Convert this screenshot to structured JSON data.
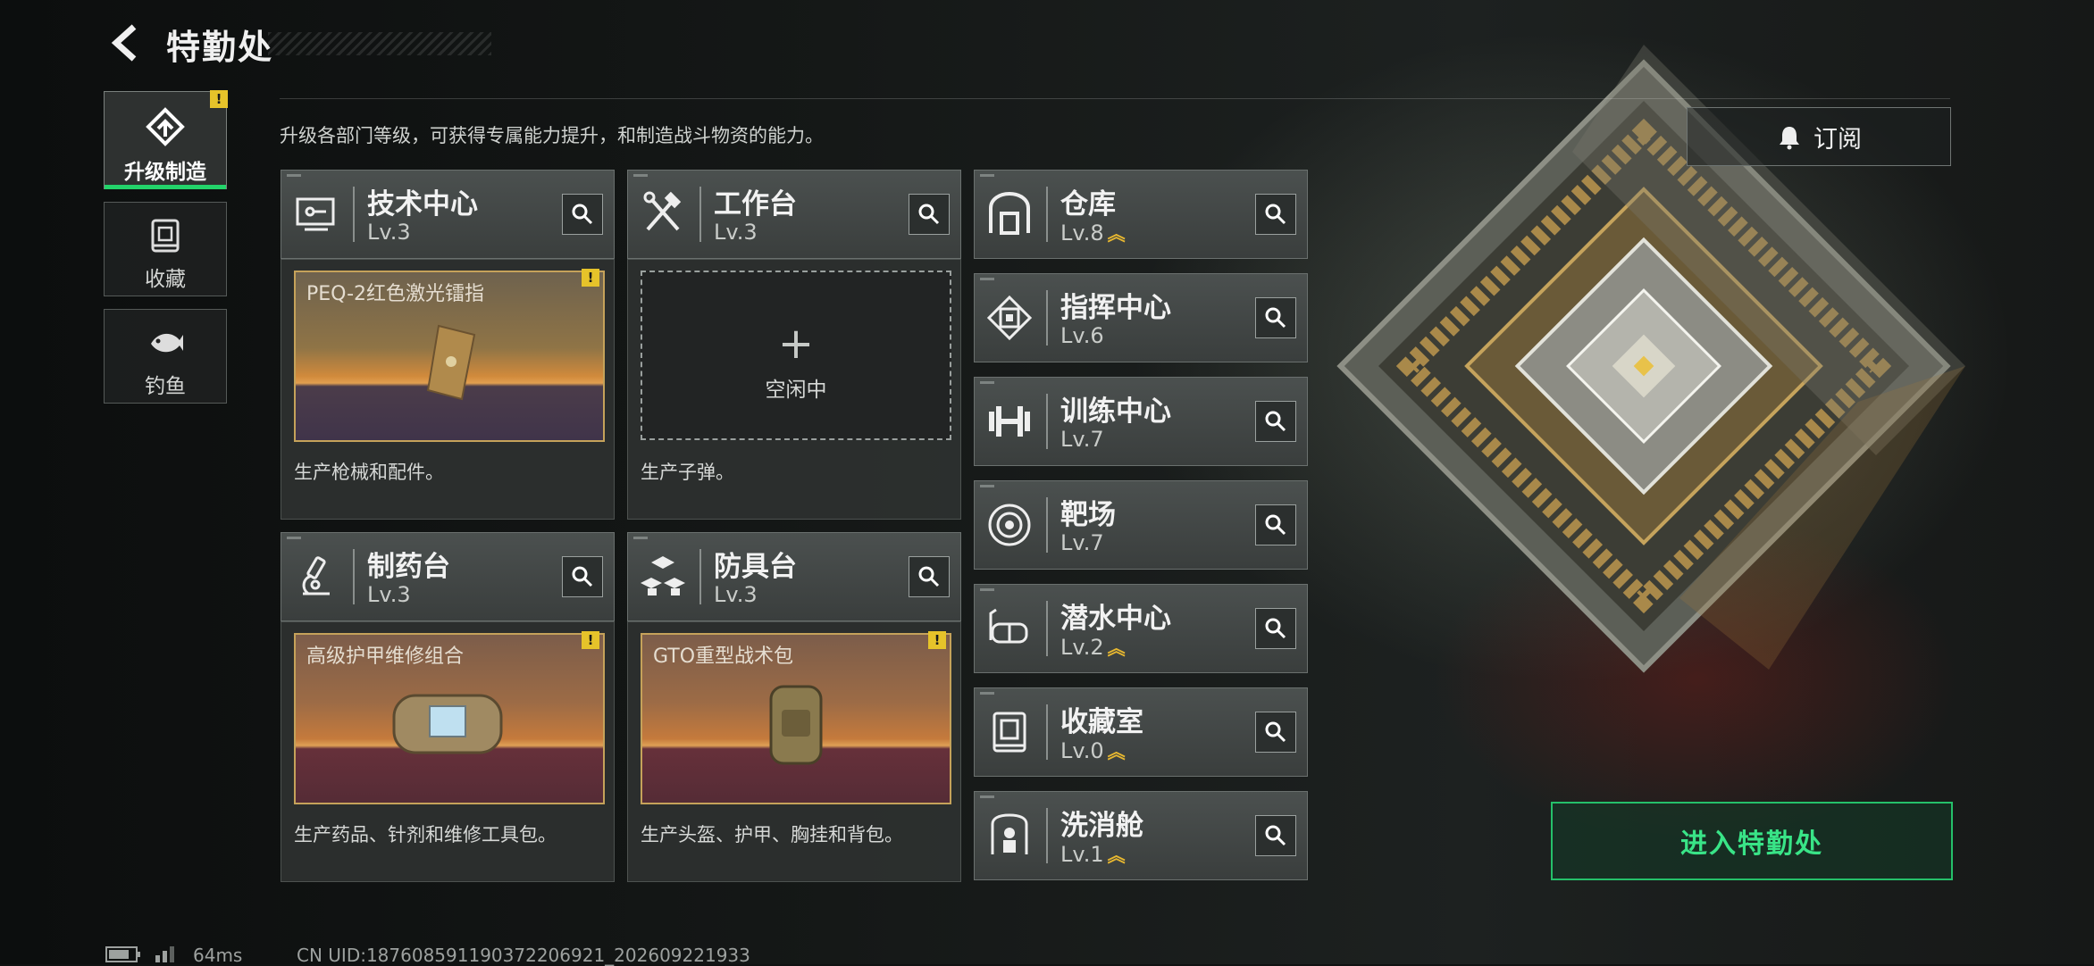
{
  "header": {
    "title": "特勤处"
  },
  "nav": {
    "tabs": [
      {
        "label": "升级制造",
        "active": true,
        "has_alert": true,
        "icon": "upgrade-icon"
      },
      {
        "label": "收藏",
        "active": false,
        "has_alert": false,
        "icon": "collection-icon"
      },
      {
        "label": "钓鱼",
        "active": false,
        "has_alert": false,
        "icon": "fish-icon"
      }
    ]
  },
  "description": "升级各部门等级，可获得专属能力提升，和制造战斗物资的能力。",
  "subscribe": {
    "label": "订阅",
    "icon": "bell-icon"
  },
  "alert_mark": "!",
  "workshops": [
    {
      "name": "技术中心",
      "level": "Lv.3",
      "icon": "tech-center-icon",
      "production": {
        "item": "PEQ-2红色激光镭指",
        "has_alert": true,
        "state": "producing"
      },
      "desc": "生产枪械和配件。"
    },
    {
      "name": "工作台",
      "level": "Lv.3",
      "icon": "workbench-icon",
      "production": {
        "state": "idle",
        "plus": "+",
        "idle_text": "空闲中"
      },
      "desc": "生产子弹。"
    },
    {
      "name": "制药台",
      "level": "Lv.3",
      "icon": "pharmacy-icon",
      "production": {
        "item": "高级护甲维修组合",
        "has_alert": true,
        "state": "producing"
      },
      "desc": "生产药品、针剂和维修工具包。"
    },
    {
      "name": "防具台",
      "level": "Lv.3",
      "icon": "armor-bench-icon",
      "production": {
        "item": "GTO重型战术包",
        "has_alert": true,
        "state": "producing"
      },
      "desc": "生产头盔、护甲、胸挂和背包。"
    }
  ],
  "facilities": [
    {
      "name": "仓库",
      "level": "Lv.8",
      "upgradable": true,
      "icon": "warehouse-icon"
    },
    {
      "name": "指挥中心",
      "level": "Lv.6",
      "upgradable": false,
      "icon": "command-center-icon"
    },
    {
      "name": "训练中心",
      "level": "Lv.7",
      "upgradable": false,
      "icon": "dumbbell-icon"
    },
    {
      "name": "靶场",
      "level": "Lv.7",
      "upgradable": false,
      "icon": "target-icon"
    },
    {
      "name": "潜水中心",
      "level": "Lv.2",
      "upgradable": true,
      "icon": "diving-mask-icon"
    },
    {
      "name": "收藏室",
      "level": "Lv.0",
      "upgradable": true,
      "icon": "collection-room-icon"
    },
    {
      "name": "洗消舱",
      "level": "Lv.1",
      "upgradable": true,
      "icon": "decon-chamber-icon"
    }
  ],
  "enter_button": {
    "label": "进入特勤处"
  },
  "footer": {
    "ping": "64ms",
    "uid": "CN UID:187608591190372206921_202609221933"
  },
  "colors": {
    "accent": "#23d36a",
    "alert": "#e6c32a",
    "upgrade_arrow": "#e8b830"
  }
}
